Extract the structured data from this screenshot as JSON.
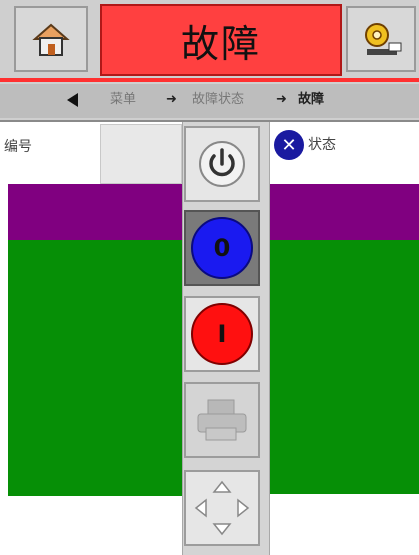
{
  "header": {
    "title": "故障",
    "home_icon": "home-icon",
    "settings_icon": "gear-icon"
  },
  "breadcrumb": {
    "prev_label": "菜单",
    "middle_label": "故障状态",
    "current_label": "故障"
  },
  "left_panel": {
    "label": "编号"
  },
  "right_panel": {
    "label": "状态"
  },
  "toolbar": {
    "power_icon": "power-icon",
    "off_label": "0",
    "on_label": "I",
    "print_icon": "printer-icon",
    "move_icon": "move-arrows-icon"
  },
  "colors": {
    "title_bg": "#ff4040",
    "purple": "#800080",
    "green": "#068f06",
    "off_blue": "#1a1af0",
    "on_red": "#ff1010"
  }
}
